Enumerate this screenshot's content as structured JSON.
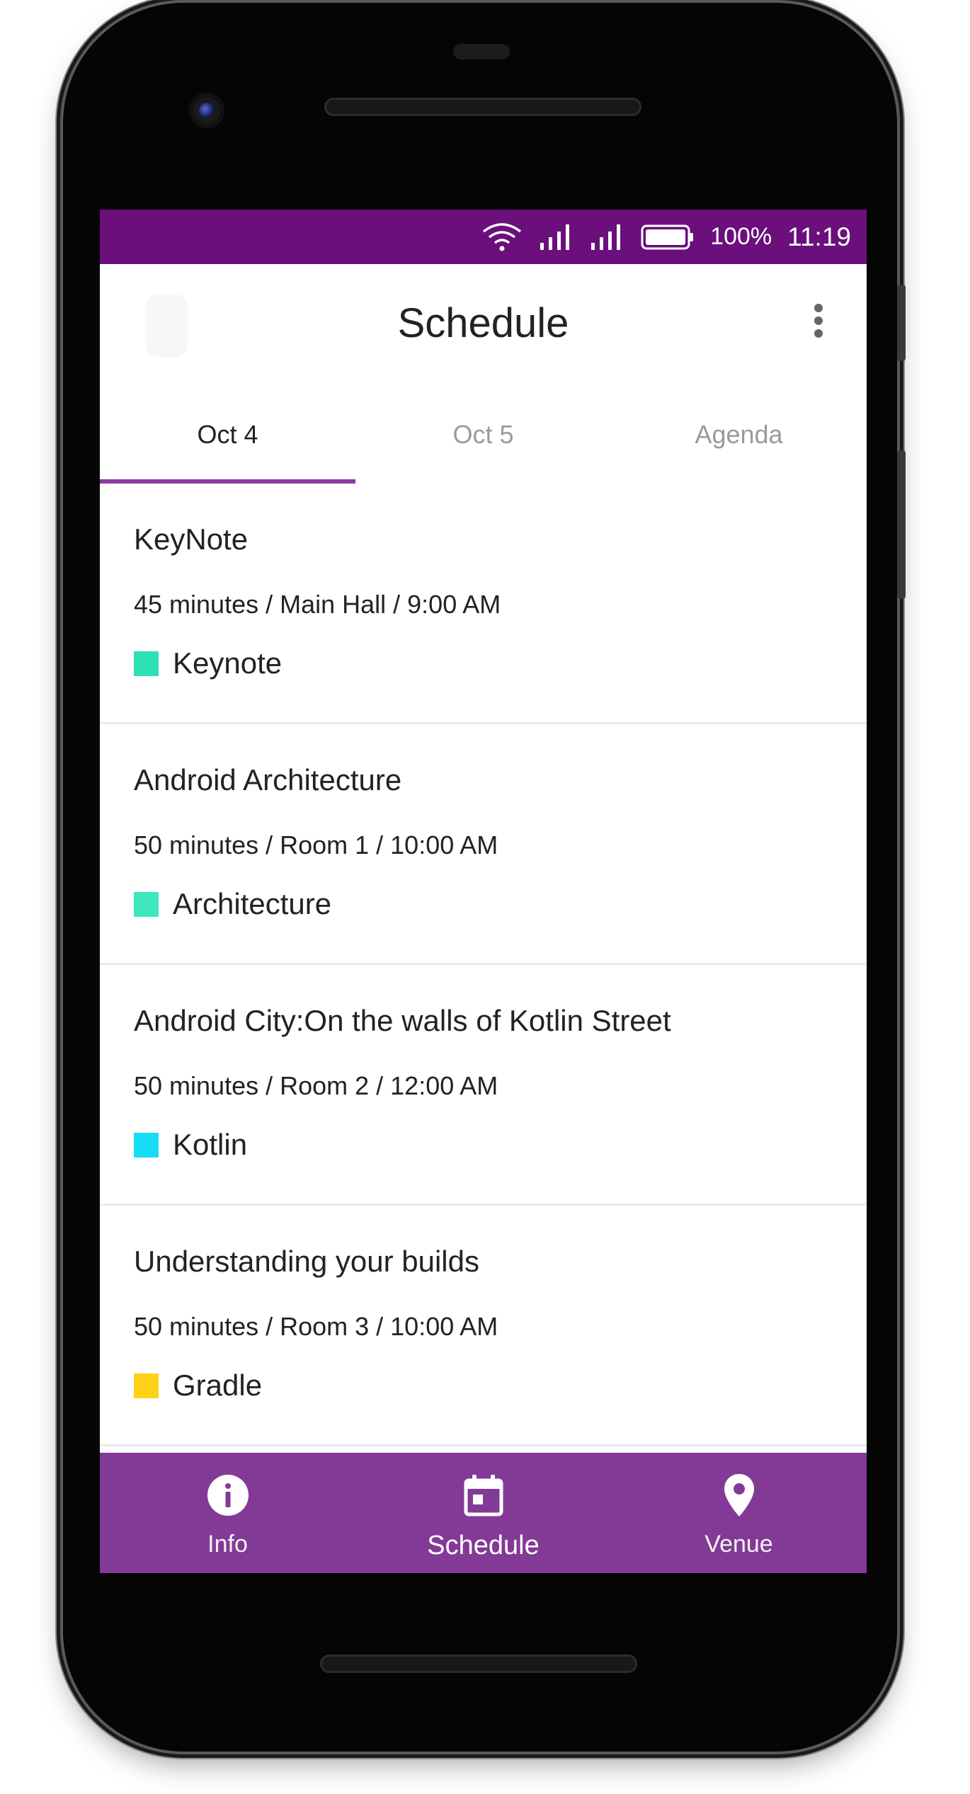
{
  "status_bar": {
    "battery": "100%",
    "time": "11:19",
    "background": "#6a0f7c"
  },
  "app_bar": {
    "title": "Schedule"
  },
  "tabs": [
    {
      "label": "Oct 4",
      "active": true
    },
    {
      "label": "Oct 5",
      "active": false
    },
    {
      "label": "Agenda",
      "active": false
    }
  ],
  "sessions": [
    {
      "title": "KeyNote",
      "meta": "45 minutes / Main Hall / 9:00 AM",
      "tag": "Keynote",
      "tag_color": "#2ee0b8"
    },
    {
      "title": "Android Architecture",
      "meta": "50 minutes / Room 1 / 10:00 AM",
      "tag": "Architecture",
      "tag_color": "#3ee6bd"
    },
    {
      "title": "Android City:On the walls of Kotlin Street",
      "meta": "50 minutes / Room 2 / 12:00 AM",
      "tag": "Kotlin",
      "tag_color": "#16dcf5"
    },
    {
      "title": "Understanding your builds",
      "meta": "50 minutes / Room 3 / 10:00 AM",
      "tag": "Gradle",
      "tag_color": "#ffd118"
    }
  ],
  "bottom_nav": [
    {
      "label": "Info",
      "icon": "info-icon",
      "active": false
    },
    {
      "label": "Schedule",
      "icon": "calendar-icon",
      "active": true
    },
    {
      "label": "Venue",
      "icon": "location-pin-icon",
      "active": false
    }
  ],
  "colors": {
    "accent": "#8a3d9b",
    "bottom_nav": "#833a96"
  }
}
